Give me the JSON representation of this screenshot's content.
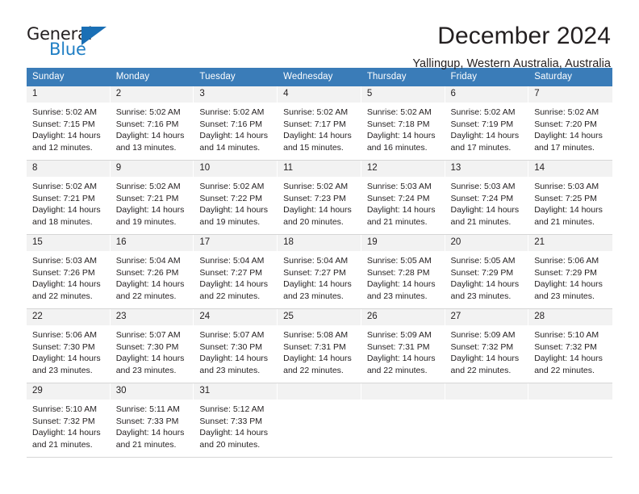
{
  "logo": {
    "primary_text": "General",
    "secondary_text": "Blue",
    "triangle_color": "#1a6fb5",
    "icon": "triangle-icon"
  },
  "header": {
    "title": "December 2024",
    "subtitle": "Yallingup, Western Australia, Australia"
  },
  "theme": {
    "header_row_bg": "#3a7cb8",
    "daynum_bg": "#f2f2f2",
    "text": "#231f20",
    "grid_line": "#d6d6d6"
  },
  "calendar": {
    "weekday_headers": [
      "Sunday",
      "Monday",
      "Tuesday",
      "Wednesday",
      "Thursday",
      "Friday",
      "Saturday"
    ],
    "labels": {
      "sunrise": "Sunrise:",
      "sunset": "Sunset:",
      "daylight": "Daylight:"
    },
    "weeks": [
      [
        {
          "day": "1",
          "sunrise": "Sunrise: 5:02 AM",
          "sunset": "Sunset: 7:15 PM",
          "daylight_line1": "Daylight: 14 hours",
          "daylight_line2": "and 12 minutes."
        },
        {
          "day": "2",
          "sunrise": "Sunrise: 5:02 AM",
          "sunset": "Sunset: 7:16 PM",
          "daylight_line1": "Daylight: 14 hours",
          "daylight_line2": "and 13 minutes."
        },
        {
          "day": "3",
          "sunrise": "Sunrise: 5:02 AM",
          "sunset": "Sunset: 7:16 PM",
          "daylight_line1": "Daylight: 14 hours",
          "daylight_line2": "and 14 minutes."
        },
        {
          "day": "4",
          "sunrise": "Sunrise: 5:02 AM",
          "sunset": "Sunset: 7:17 PM",
          "daylight_line1": "Daylight: 14 hours",
          "daylight_line2": "and 15 minutes."
        },
        {
          "day": "5",
          "sunrise": "Sunrise: 5:02 AM",
          "sunset": "Sunset: 7:18 PM",
          "daylight_line1": "Daylight: 14 hours",
          "daylight_line2": "and 16 minutes."
        },
        {
          "day": "6",
          "sunrise": "Sunrise: 5:02 AM",
          "sunset": "Sunset: 7:19 PM",
          "daylight_line1": "Daylight: 14 hours",
          "daylight_line2": "and 17 minutes."
        },
        {
          "day": "7",
          "sunrise": "Sunrise: 5:02 AM",
          "sunset": "Sunset: 7:20 PM",
          "daylight_line1": "Daylight: 14 hours",
          "daylight_line2": "and 17 minutes."
        }
      ],
      [
        {
          "day": "8",
          "sunrise": "Sunrise: 5:02 AM",
          "sunset": "Sunset: 7:21 PM",
          "daylight_line1": "Daylight: 14 hours",
          "daylight_line2": "and 18 minutes."
        },
        {
          "day": "9",
          "sunrise": "Sunrise: 5:02 AM",
          "sunset": "Sunset: 7:21 PM",
          "daylight_line1": "Daylight: 14 hours",
          "daylight_line2": "and 19 minutes."
        },
        {
          "day": "10",
          "sunrise": "Sunrise: 5:02 AM",
          "sunset": "Sunset: 7:22 PM",
          "daylight_line1": "Daylight: 14 hours",
          "daylight_line2": "and 19 minutes."
        },
        {
          "day": "11",
          "sunrise": "Sunrise: 5:02 AM",
          "sunset": "Sunset: 7:23 PM",
          "daylight_line1": "Daylight: 14 hours",
          "daylight_line2": "and 20 minutes."
        },
        {
          "day": "12",
          "sunrise": "Sunrise: 5:03 AM",
          "sunset": "Sunset: 7:24 PM",
          "daylight_line1": "Daylight: 14 hours",
          "daylight_line2": "and 21 minutes."
        },
        {
          "day": "13",
          "sunrise": "Sunrise: 5:03 AM",
          "sunset": "Sunset: 7:24 PM",
          "daylight_line1": "Daylight: 14 hours",
          "daylight_line2": "and 21 minutes."
        },
        {
          "day": "14",
          "sunrise": "Sunrise: 5:03 AM",
          "sunset": "Sunset: 7:25 PM",
          "daylight_line1": "Daylight: 14 hours",
          "daylight_line2": "and 21 minutes."
        }
      ],
      [
        {
          "day": "15",
          "sunrise": "Sunrise: 5:03 AM",
          "sunset": "Sunset: 7:26 PM",
          "daylight_line1": "Daylight: 14 hours",
          "daylight_line2": "and 22 minutes."
        },
        {
          "day": "16",
          "sunrise": "Sunrise: 5:04 AM",
          "sunset": "Sunset: 7:26 PM",
          "daylight_line1": "Daylight: 14 hours",
          "daylight_line2": "and 22 minutes."
        },
        {
          "day": "17",
          "sunrise": "Sunrise: 5:04 AM",
          "sunset": "Sunset: 7:27 PM",
          "daylight_line1": "Daylight: 14 hours",
          "daylight_line2": "and 22 minutes."
        },
        {
          "day": "18",
          "sunrise": "Sunrise: 5:04 AM",
          "sunset": "Sunset: 7:27 PM",
          "daylight_line1": "Daylight: 14 hours",
          "daylight_line2": "and 23 minutes."
        },
        {
          "day": "19",
          "sunrise": "Sunrise: 5:05 AM",
          "sunset": "Sunset: 7:28 PM",
          "daylight_line1": "Daylight: 14 hours",
          "daylight_line2": "and 23 minutes."
        },
        {
          "day": "20",
          "sunrise": "Sunrise: 5:05 AM",
          "sunset": "Sunset: 7:29 PM",
          "daylight_line1": "Daylight: 14 hours",
          "daylight_line2": "and 23 minutes."
        },
        {
          "day": "21",
          "sunrise": "Sunrise: 5:06 AM",
          "sunset": "Sunset: 7:29 PM",
          "daylight_line1": "Daylight: 14 hours",
          "daylight_line2": "and 23 minutes."
        }
      ],
      [
        {
          "day": "22",
          "sunrise": "Sunrise: 5:06 AM",
          "sunset": "Sunset: 7:30 PM",
          "daylight_line1": "Daylight: 14 hours",
          "daylight_line2": "and 23 minutes."
        },
        {
          "day": "23",
          "sunrise": "Sunrise: 5:07 AM",
          "sunset": "Sunset: 7:30 PM",
          "daylight_line1": "Daylight: 14 hours",
          "daylight_line2": "and 23 minutes."
        },
        {
          "day": "24",
          "sunrise": "Sunrise: 5:07 AM",
          "sunset": "Sunset: 7:30 PM",
          "daylight_line1": "Daylight: 14 hours",
          "daylight_line2": "and 23 minutes."
        },
        {
          "day": "25",
          "sunrise": "Sunrise: 5:08 AM",
          "sunset": "Sunset: 7:31 PM",
          "daylight_line1": "Daylight: 14 hours",
          "daylight_line2": "and 22 minutes."
        },
        {
          "day": "26",
          "sunrise": "Sunrise: 5:09 AM",
          "sunset": "Sunset: 7:31 PM",
          "daylight_line1": "Daylight: 14 hours",
          "daylight_line2": "and 22 minutes."
        },
        {
          "day": "27",
          "sunrise": "Sunrise: 5:09 AM",
          "sunset": "Sunset: 7:32 PM",
          "daylight_line1": "Daylight: 14 hours",
          "daylight_line2": "and 22 minutes."
        },
        {
          "day": "28",
          "sunrise": "Sunrise: 5:10 AM",
          "sunset": "Sunset: 7:32 PM",
          "daylight_line1": "Daylight: 14 hours",
          "daylight_line2": "and 22 minutes."
        }
      ],
      [
        {
          "day": "29",
          "sunrise": "Sunrise: 5:10 AM",
          "sunset": "Sunset: 7:32 PM",
          "daylight_line1": "Daylight: 14 hours",
          "daylight_line2": "and 21 minutes."
        },
        {
          "day": "30",
          "sunrise": "Sunrise: 5:11 AM",
          "sunset": "Sunset: 7:33 PM",
          "daylight_line1": "Daylight: 14 hours",
          "daylight_line2": "and 21 minutes."
        },
        {
          "day": "31",
          "sunrise": "Sunrise: 5:12 AM",
          "sunset": "Sunset: 7:33 PM",
          "daylight_line1": "Daylight: 14 hours",
          "daylight_line2": "and 20 minutes."
        },
        {
          "day": "",
          "sunrise": "",
          "sunset": "",
          "daylight_line1": "",
          "daylight_line2": ""
        },
        {
          "day": "",
          "sunrise": "",
          "sunset": "",
          "daylight_line1": "",
          "daylight_line2": ""
        },
        {
          "day": "",
          "sunrise": "",
          "sunset": "",
          "daylight_line1": "",
          "daylight_line2": ""
        },
        {
          "day": "",
          "sunrise": "",
          "sunset": "",
          "daylight_line1": "",
          "daylight_line2": ""
        }
      ]
    ]
  }
}
